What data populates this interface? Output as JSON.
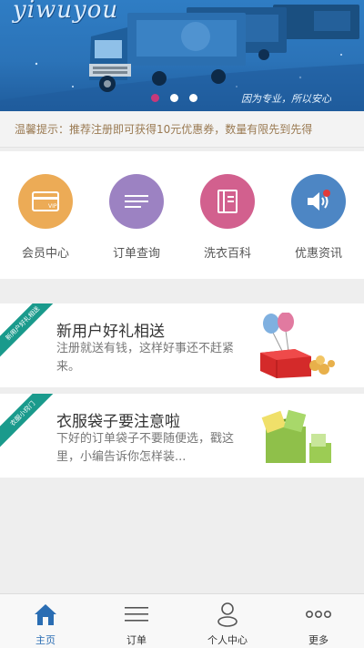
{
  "banner": {
    "brand": "yiwuyou",
    "slogan": "因为专业，所以安心",
    "slides": 3,
    "active_slide": 0
  },
  "notice": {
    "text": "温馨提示：推荐注册即可获得10元优惠券，数量有限先到先得"
  },
  "shortcuts": [
    {
      "label": "会员中心",
      "icon": "vip-card-icon",
      "color": "#ecab56"
    },
    {
      "label": "订单查询",
      "icon": "list-lines-icon",
      "color": "#9c82c2"
    },
    {
      "label": "洗衣百科",
      "icon": "book-icon",
      "color": "#d2608e"
    },
    {
      "label": "优惠资讯",
      "icon": "speaker-icon",
      "color": "#4d86c4"
    }
  ],
  "cards": [
    {
      "ribbon": "新用户好礼相送",
      "title": "新用户好礼相送",
      "desc": "注册就送有钱，这样好事还不赶紧来。",
      "image": "gift-box-balloons-icon"
    },
    {
      "ribbon": "衣服小窍门",
      "title": "衣服袋子要注意啦",
      "desc": "下好的订单袋子不要随便选，戳这里，小编告诉你怎样装...",
      "image": "laundry-bags-icon"
    }
  ],
  "tabs": [
    {
      "label": "主页",
      "icon": "home-icon",
      "active": true
    },
    {
      "label": "订单",
      "icon": "menu-lines-icon",
      "active": false
    },
    {
      "label": "个人中心",
      "icon": "person-icon",
      "active": false
    },
    {
      "label": "更多",
      "icon": "more-dots-icon",
      "active": false
    }
  ],
  "colors": {
    "accent": "#2a6db3",
    "ribbon": "#1a9a8c",
    "notice_text": "#9a7a52"
  }
}
